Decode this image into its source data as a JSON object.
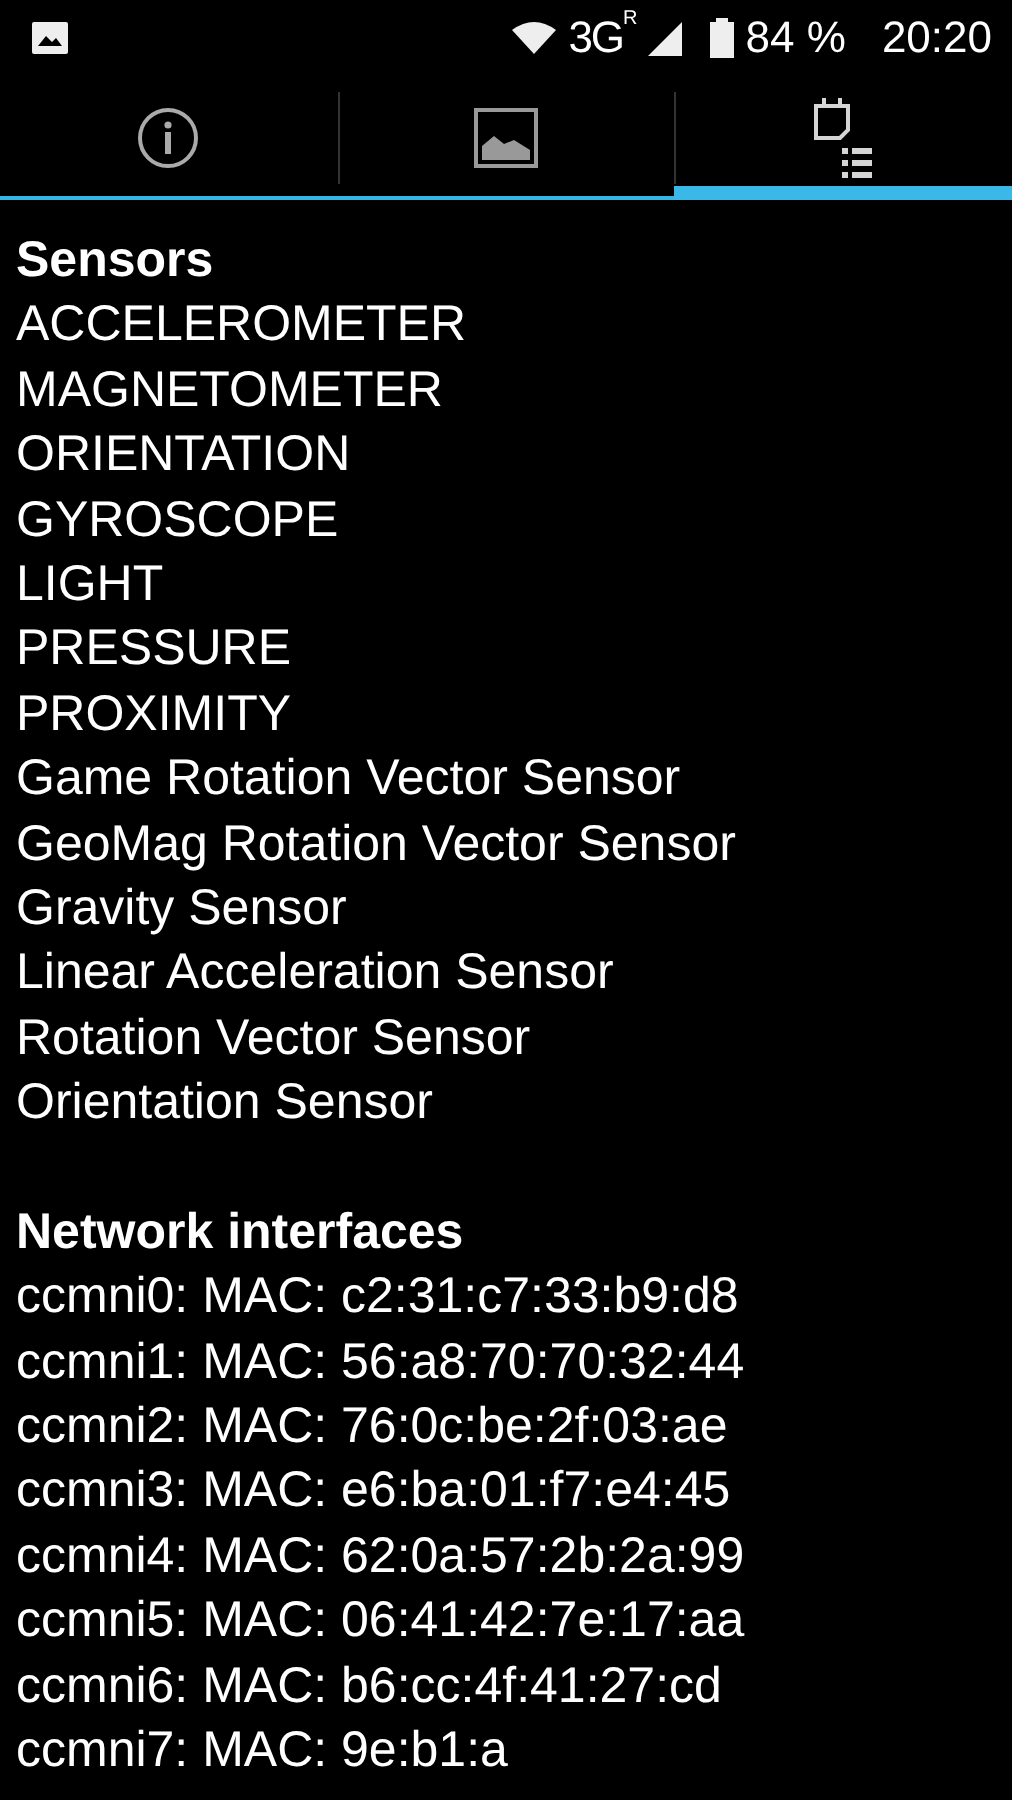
{
  "status_bar": {
    "network": "3G",
    "roaming": "R",
    "battery": "84 %",
    "time": "20:20"
  },
  "tabs": [
    {
      "kind": "info",
      "selected": false
    },
    {
      "kind": "image",
      "selected": false
    },
    {
      "kind": "list",
      "selected": true
    }
  ],
  "sections": [
    {
      "title": "Sensors",
      "items": [
        "ACCELEROMETER",
        "MAGNETOMETER",
        "ORIENTATION",
        "GYROSCOPE",
        "LIGHT",
        "PRESSURE",
        "PROXIMITY",
        "Game Rotation Vector Sensor",
        "GeoMag Rotation Vector Sensor",
        "Gravity Sensor",
        "Linear Acceleration Sensor",
        "Rotation Vector Sensor",
        "Orientation Sensor"
      ]
    },
    {
      "title": "Network interfaces",
      "items": [
        "ccmni0: MAC: c2:31:c7:33:b9:d8",
        "ccmni1: MAC: 56:a8:70:70:32:44",
        "ccmni2: MAC: 76:0c:be:2f:03:ae",
        "ccmni3: MAC: e6:ba:01:f7:e4:45",
        "ccmni4: MAC: 62:0a:57:2b:2a:99",
        "ccmni5: MAC: 06:41:42:7e:17:aa",
        "ccmni6: MAC: b6:cc:4f:41:27:cd",
        "ccmni7: MAC: 9e:b1:a"
      ]
    }
  ]
}
